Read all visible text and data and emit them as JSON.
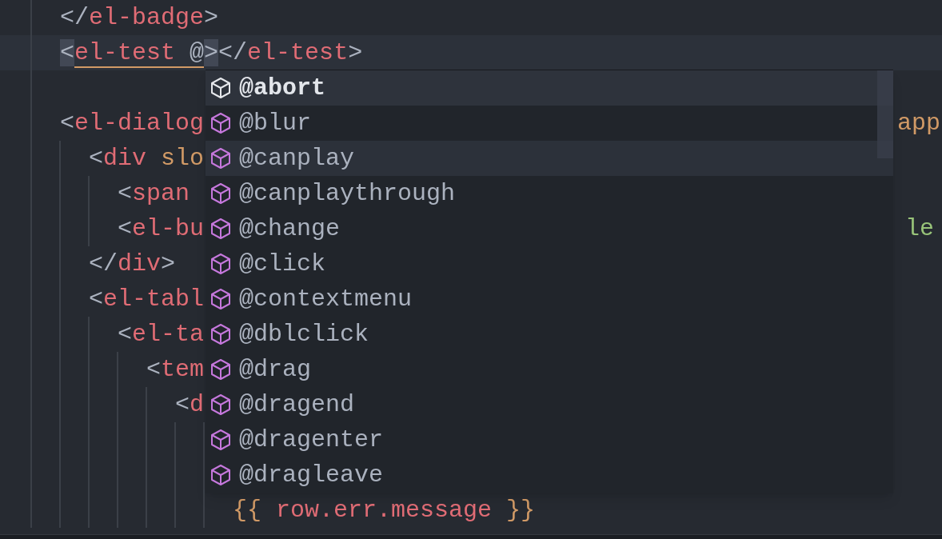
{
  "editor": {
    "lines": [
      {
        "kind": "code",
        "segments": [
          {
            "text": "  </",
            "kind": "punct"
          },
          {
            "text": "el-badge",
            "kind": "tag"
          },
          {
            "text": ">",
            "kind": "punct"
          }
        ]
      },
      {
        "kind": "code",
        "current": true,
        "segments": [
          {
            "text": "  <",
            "kind": "punct",
            "matched": true
          },
          {
            "text": "el-test",
            "kind": "tag",
            "underline": true
          },
          {
            "text": " @",
            "kind": "punct",
            "underline": true
          },
          {
            "text": ">",
            "kind": "punct",
            "matched": true
          },
          {
            "text": "</",
            "kind": "punct"
          },
          {
            "text": "el-test",
            "kind": "tag"
          },
          {
            "text": ">",
            "kind": "punct"
          }
        ]
      },
      {
        "kind": "blank"
      },
      {
        "kind": "code",
        "segments": [
          {
            "text": "  <",
            "kind": "punct"
          },
          {
            "text": "el-dialog",
            "kind": "tag"
          }
        ],
        "right": [
          {
            "text": "app",
            "kind": "attr"
          }
        ]
      },
      {
        "kind": "code",
        "segments": [
          {
            "text": "    <",
            "kind": "punct"
          },
          {
            "text": "div",
            "kind": "tag"
          },
          {
            "text": " slo",
            "kind": "attr"
          }
        ]
      },
      {
        "kind": "code",
        "segments": [
          {
            "text": "      <",
            "kind": "punct"
          },
          {
            "text": "span",
            "kind": "tag"
          }
        ]
      },
      {
        "kind": "code",
        "segments": [
          {
            "text": "      <",
            "kind": "punct"
          },
          {
            "text": "el-bu",
            "kind": "tag"
          }
        ],
        "right": [
          {
            "text": "le",
            "kind": "string"
          }
        ]
      },
      {
        "kind": "code",
        "segments": [
          {
            "text": "    </",
            "kind": "punct"
          },
          {
            "text": "div",
            "kind": "tag"
          },
          {
            "text": ">",
            "kind": "punct"
          }
        ]
      },
      {
        "kind": "code",
        "segments": [
          {
            "text": "    <",
            "kind": "punct"
          },
          {
            "text": "el-tabl",
            "kind": "tag"
          }
        ]
      },
      {
        "kind": "code",
        "segments": [
          {
            "text": "      <",
            "kind": "punct"
          },
          {
            "text": "el-ta",
            "kind": "tag"
          }
        ]
      },
      {
        "kind": "code",
        "segments": [
          {
            "text": "        <",
            "kind": "punct"
          },
          {
            "text": "tem",
            "kind": "tag"
          }
        ]
      },
      {
        "kind": "code",
        "segments": [
          {
            "text": "          <",
            "kind": "punct"
          },
          {
            "text": "d",
            "kind": "tag"
          }
        ]
      },
      {
        "kind": "blank"
      },
      {
        "kind": "blank"
      },
      {
        "kind": "code",
        "segments": [
          {
            "text": "              {{ ",
            "kind": "attr"
          },
          {
            "text": "row.err.message",
            "kind": "tag"
          },
          {
            "text": " }}",
            "kind": "attr"
          }
        ]
      }
    ]
  },
  "suggestions": {
    "items": [
      {
        "label": "@abort",
        "selected": true,
        "hovered": false
      },
      {
        "label": "@blur",
        "selected": false,
        "hovered": false
      },
      {
        "label": "@canplay",
        "selected": false,
        "hovered": true
      },
      {
        "label": "@canplaythrough",
        "selected": false,
        "hovered": false
      },
      {
        "label": "@change",
        "selected": false,
        "hovered": false
      },
      {
        "label": "@click",
        "selected": false,
        "hovered": false
      },
      {
        "label": "@contextmenu",
        "selected": false,
        "hovered": false
      },
      {
        "label": "@dblclick",
        "selected": false,
        "hovered": false
      },
      {
        "label": "@drag",
        "selected": false,
        "hovered": false
      },
      {
        "label": "@dragend",
        "selected": false,
        "hovered": false
      },
      {
        "label": "@dragenter",
        "selected": false,
        "hovered": false
      },
      {
        "label": "@dragleave",
        "selected": false,
        "hovered": false
      }
    ]
  }
}
